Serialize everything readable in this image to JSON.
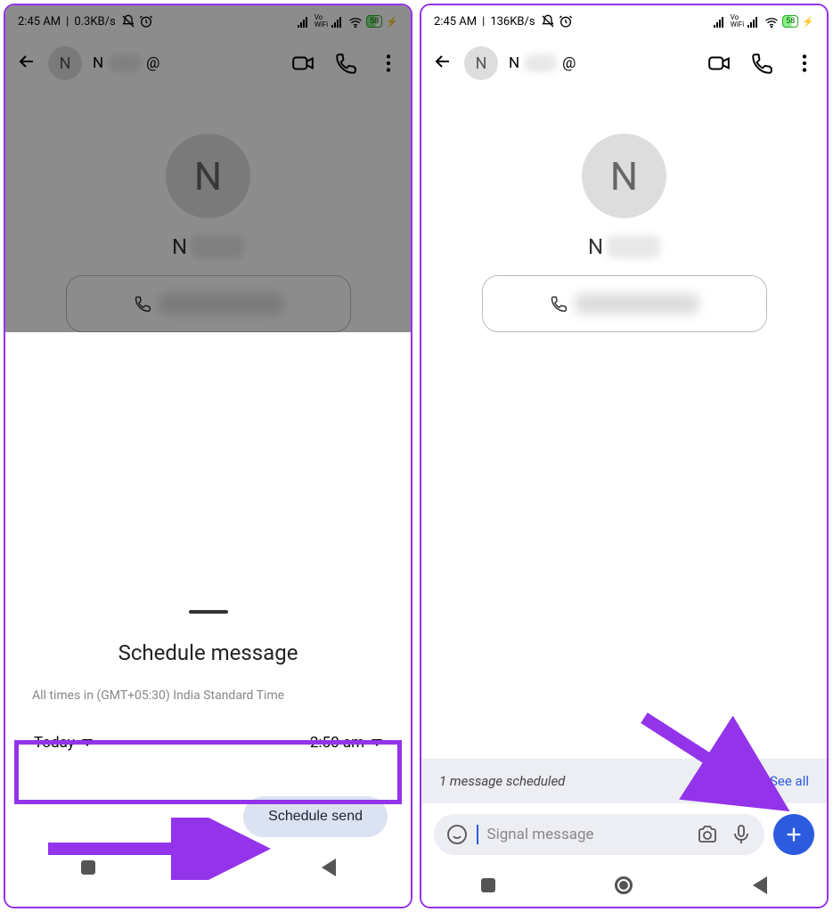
{
  "left": {
    "status": {
      "time": "2:45 AM",
      "net": "0.3KB/s",
      "battery": "58"
    },
    "top": {
      "avatar_initial": "N",
      "name_prefix": "N",
      "at": "@"
    },
    "body": {
      "avatar_initial": "N",
      "name_prefix": "N"
    },
    "sheet": {
      "title": "Schedule message",
      "tz_note": "All times in (GMT+05:30) India Standard Time",
      "date": "Today",
      "time": "2:50 am",
      "button": "Schedule send"
    }
  },
  "right": {
    "status": {
      "time": "2:45 AM",
      "net": "136KB/s",
      "battery": "58"
    },
    "top": {
      "avatar_initial": "N",
      "name_prefix": "N",
      "at": "@"
    },
    "body": {
      "avatar_initial": "N",
      "name_prefix": "N"
    },
    "banner": {
      "text": "1 message scheduled",
      "link": "See all"
    },
    "compose": {
      "placeholder": "Signal message"
    }
  }
}
